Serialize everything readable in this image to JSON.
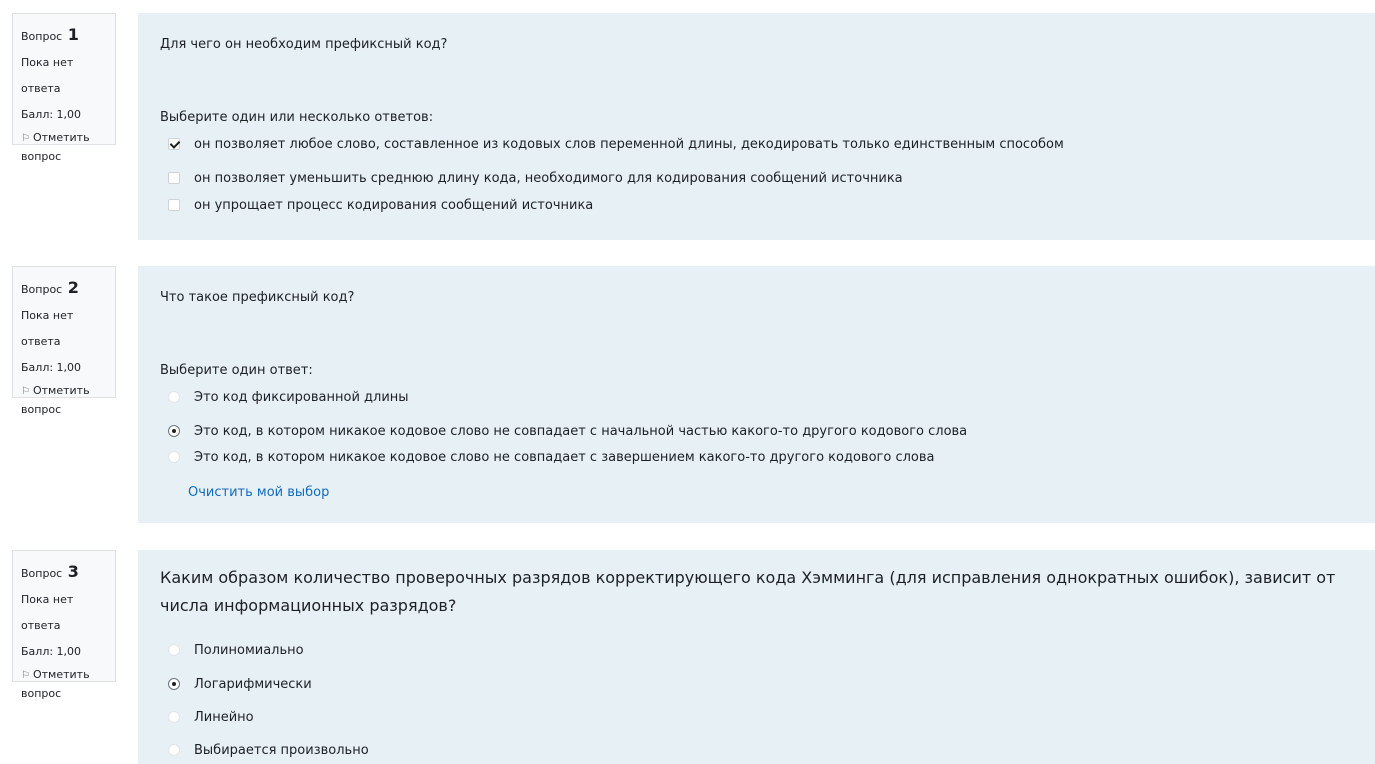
{
  "questions": [
    {
      "label": "Вопрос",
      "number": "1",
      "status": "Пока нет ответа",
      "mark": "Балл: 1,00",
      "flag": "Отметить вопрос",
      "text": "Для чего он необходим префиксный код?",
      "prompt": "Выберите один или несколько ответов:",
      "type": "checkbox",
      "options": [
        {
          "label": "он позволяет любое слово, составленное из кодовых слов переменной длины, декодировать только единственным способом",
          "checked": true
        },
        {
          "label": "он позволяет уменьшить среднюю длину кода, необходимого для кодирования сообщений источника",
          "checked": false
        },
        {
          "label": "он упрощает процесс кодирования сообщений источника",
          "checked": false
        }
      ]
    },
    {
      "label": "Вопрос",
      "number": "2",
      "status": "Пока нет ответа",
      "mark": "Балл: 1,00",
      "flag": "Отметить вопрос",
      "text": "Что такое префиксный код?",
      "prompt": "Выберите один ответ:",
      "type": "radio",
      "options": [
        {
          "label": "Это код фиксированной длины",
          "checked": false
        },
        {
          "label": "Это код, в котором никакое кодовое слово не совпадает с начальной частью какого-то другого кодового слова",
          "checked": true
        },
        {
          "label": "Это код, в котором никакое кодовое слово не совпадает с завершением какого-то другого кодового слова",
          "checked": false
        }
      ],
      "clear_label": "Очистить мой выбор"
    },
    {
      "label": "Вопрос",
      "number": "3",
      "status": "Пока нет ответа",
      "mark": "Балл: 1,00",
      "flag": "Отметить вопрос",
      "text": "Каким образом количество проверочных разрядов корректирующего кода Хэмминга (для исправления однократных ошибок),  зависит от числа информационных разрядов?",
      "type": "radio",
      "options": [
        {
          "label": "Полиномиально",
          "checked": false
        },
        {
          "label": "Логарифмически",
          "checked": true
        },
        {
          "label": "Линейно",
          "checked": false
        },
        {
          "label": "Выбирается произвольно",
          "checked": false
        }
      ]
    }
  ],
  "icons": {
    "flag": "flag-icon"
  },
  "colors": {
    "panel_bg": "#e7f0f5",
    "info_bg": "#f8f9fa",
    "link": "#0f6cbf"
  }
}
